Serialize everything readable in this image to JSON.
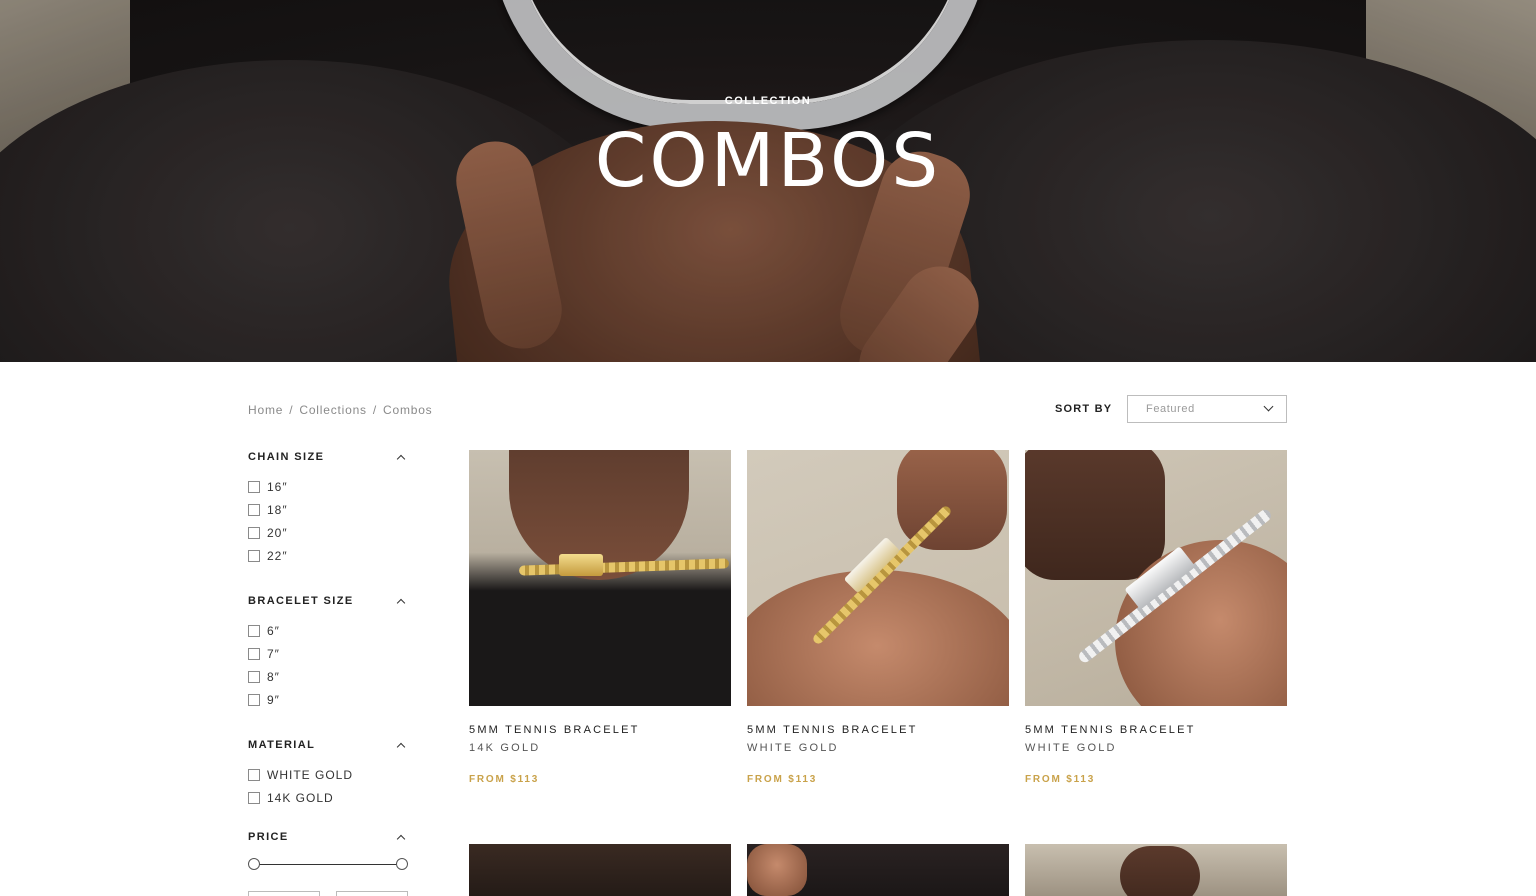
{
  "hero": {
    "eyebrow": "COLLECTION",
    "title": "COMBOS"
  },
  "breadcrumb": [
    "Home",
    "/",
    "Collections",
    "/",
    "Combos"
  ],
  "sort": {
    "label": "SORT BY",
    "selected": "Featured"
  },
  "filters": [
    {
      "title": "CHAIN SIZE",
      "options": [
        "16″",
        "18″",
        "20″",
        "22″"
      ]
    },
    {
      "title": "BRACELET SIZE",
      "options": [
        "6″",
        "7″",
        "8″",
        "9″"
      ]
    },
    {
      "title": "MATERIAL",
      "options": [
        "WHITE GOLD",
        "14K GOLD"
      ]
    },
    {
      "title": "PRICE",
      "options": []
    }
  ],
  "products": [
    {
      "name": "5MM TENNIS BRACELET",
      "variant": "14K GOLD",
      "price": "FROM $113"
    },
    {
      "name": "5MM TENNIS BRACELET",
      "variant": "WHITE GOLD",
      "price": "FROM $113"
    },
    {
      "name": "5MM TENNIS BRACELET",
      "variant": "WHITE GOLD",
      "price": "FROM $113"
    }
  ],
  "colors": {
    "accent_price": "#c9a24a",
    "text": "#222222",
    "muted": "#8a8a8a"
  },
  "icons": {
    "sort_chevron": "chevron-down-icon",
    "filter_toggle": "chevron-up-icon"
  }
}
